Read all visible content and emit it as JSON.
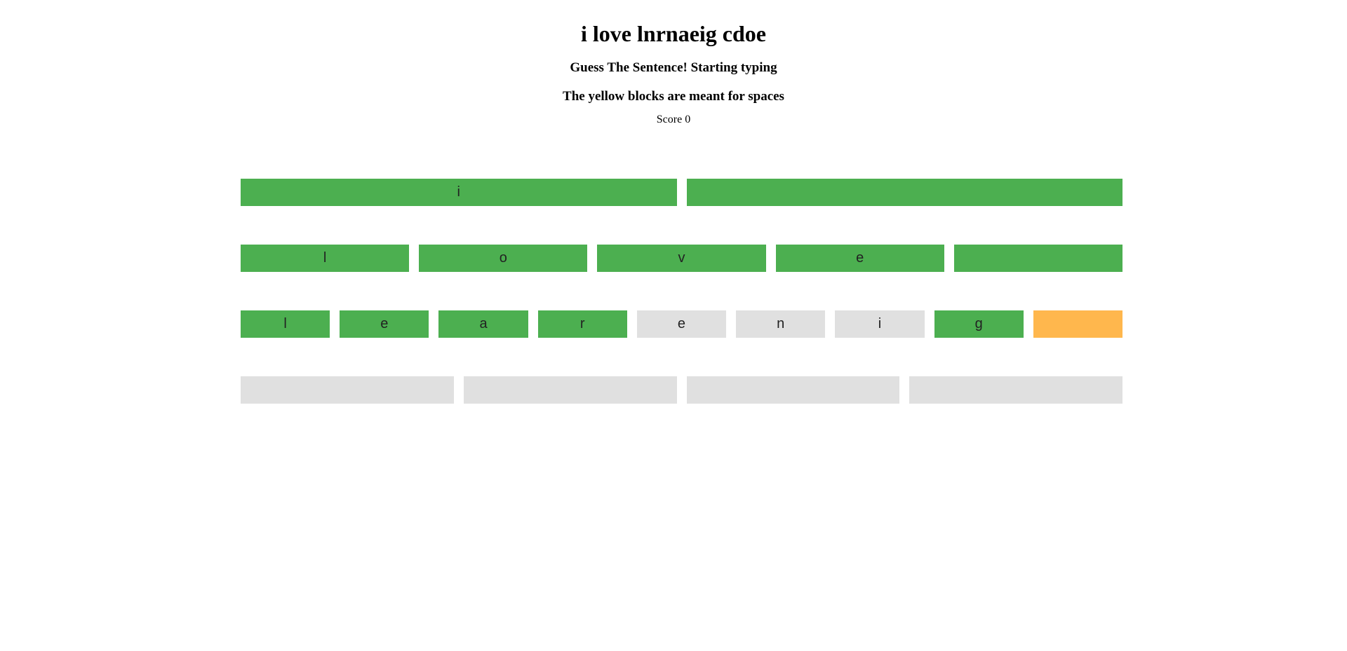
{
  "title": "i love lnrnaeig cdoe",
  "subtitle": "Guess The Sentence! Starting typing",
  "instructions": "The yellow blocks are meant for spaces",
  "score": {
    "label": "Score 0"
  },
  "colors": {
    "correct": "#4caf50",
    "empty": "#e0e0e0",
    "space": "#ffb74d"
  },
  "rows": [
    [
      {
        "letter": "i",
        "state": "correct"
      },
      {
        "letter": "",
        "state": "correct"
      }
    ],
    [
      {
        "letter": "l",
        "state": "correct"
      },
      {
        "letter": "o",
        "state": "correct"
      },
      {
        "letter": "v",
        "state": "correct"
      },
      {
        "letter": "e",
        "state": "correct"
      },
      {
        "letter": "",
        "state": "correct"
      }
    ],
    [
      {
        "letter": "l",
        "state": "correct"
      },
      {
        "letter": "e",
        "state": "correct"
      },
      {
        "letter": "a",
        "state": "correct"
      },
      {
        "letter": "r",
        "state": "correct"
      },
      {
        "letter": "e",
        "state": "empty"
      },
      {
        "letter": "n",
        "state": "empty"
      },
      {
        "letter": "i",
        "state": "empty"
      },
      {
        "letter": "g",
        "state": "correct"
      },
      {
        "letter": "",
        "state": "space"
      }
    ],
    [
      {
        "letter": "",
        "state": "empty"
      },
      {
        "letter": "",
        "state": "empty"
      },
      {
        "letter": "",
        "state": "empty"
      },
      {
        "letter": "",
        "state": "empty"
      }
    ]
  ]
}
